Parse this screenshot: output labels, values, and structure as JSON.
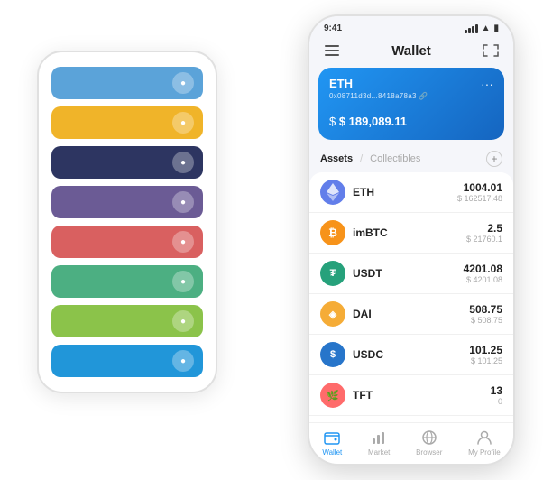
{
  "scene": {
    "bg_phone": {
      "cards": [
        {
          "id": "card-1",
          "color_class": "card-row-1",
          "icon": "●"
        },
        {
          "id": "card-2",
          "color_class": "card-row-2",
          "icon": "●"
        },
        {
          "id": "card-3",
          "color_class": "card-row-3",
          "icon": "●"
        },
        {
          "id": "card-4",
          "color_class": "card-row-4",
          "icon": "●"
        },
        {
          "id": "card-5",
          "color_class": "card-row-5",
          "icon": "●"
        },
        {
          "id": "card-6",
          "color_class": "card-row-6",
          "icon": "●"
        },
        {
          "id": "card-7",
          "color_class": "card-row-7",
          "icon": "●"
        },
        {
          "id": "card-8",
          "color_class": "card-row-8",
          "icon": "●"
        }
      ]
    },
    "fg_phone": {
      "status_bar": {
        "time": "9:41"
      },
      "header": {
        "menu_icon": "≡",
        "title": "Wallet",
        "expand_icon": "⇄"
      },
      "eth_card": {
        "currency": "ETH",
        "address": "0x08711d3d...8418a78a3 🔗",
        "amount_label": "$ 189,089.11"
      },
      "assets_section": {
        "tab_active": "Assets",
        "divider": "/",
        "tab_inactive": "Collectibles",
        "add_icon": "+"
      },
      "tokens": [
        {
          "name": "ETH",
          "logo_emoji": "♦",
          "logo_class": "eth-logo",
          "amount": "1004.01",
          "usd": "$ 162517.48"
        },
        {
          "name": "imBTC",
          "logo_emoji": "₿",
          "logo_class": "imbtc-logo",
          "amount": "2.5",
          "usd": "$ 21760.1"
        },
        {
          "name": "USDT",
          "logo_emoji": "₮",
          "logo_class": "usdt-logo",
          "amount": "4201.08",
          "usd": "$ 4201.08"
        },
        {
          "name": "DAI",
          "logo_emoji": "◈",
          "logo_class": "dai-logo",
          "amount": "508.75",
          "usd": "$ 508.75"
        },
        {
          "name": "USDC",
          "logo_emoji": "$",
          "logo_class": "usdc-logo",
          "amount": "101.25",
          "usd": "$ 101.25"
        },
        {
          "name": "TFT",
          "logo_emoji": "🌿",
          "logo_class": "tft-logo",
          "amount": "13",
          "usd": "0"
        }
      ],
      "bottom_nav": [
        {
          "id": "wallet",
          "label": "Wallet",
          "icon": "◎",
          "active": true
        },
        {
          "id": "market",
          "label": "Market",
          "icon": "📊",
          "active": false
        },
        {
          "id": "browser",
          "label": "Browser",
          "icon": "⊕",
          "active": false
        },
        {
          "id": "profile",
          "label": "My Profile",
          "icon": "👤",
          "active": false
        }
      ]
    }
  }
}
